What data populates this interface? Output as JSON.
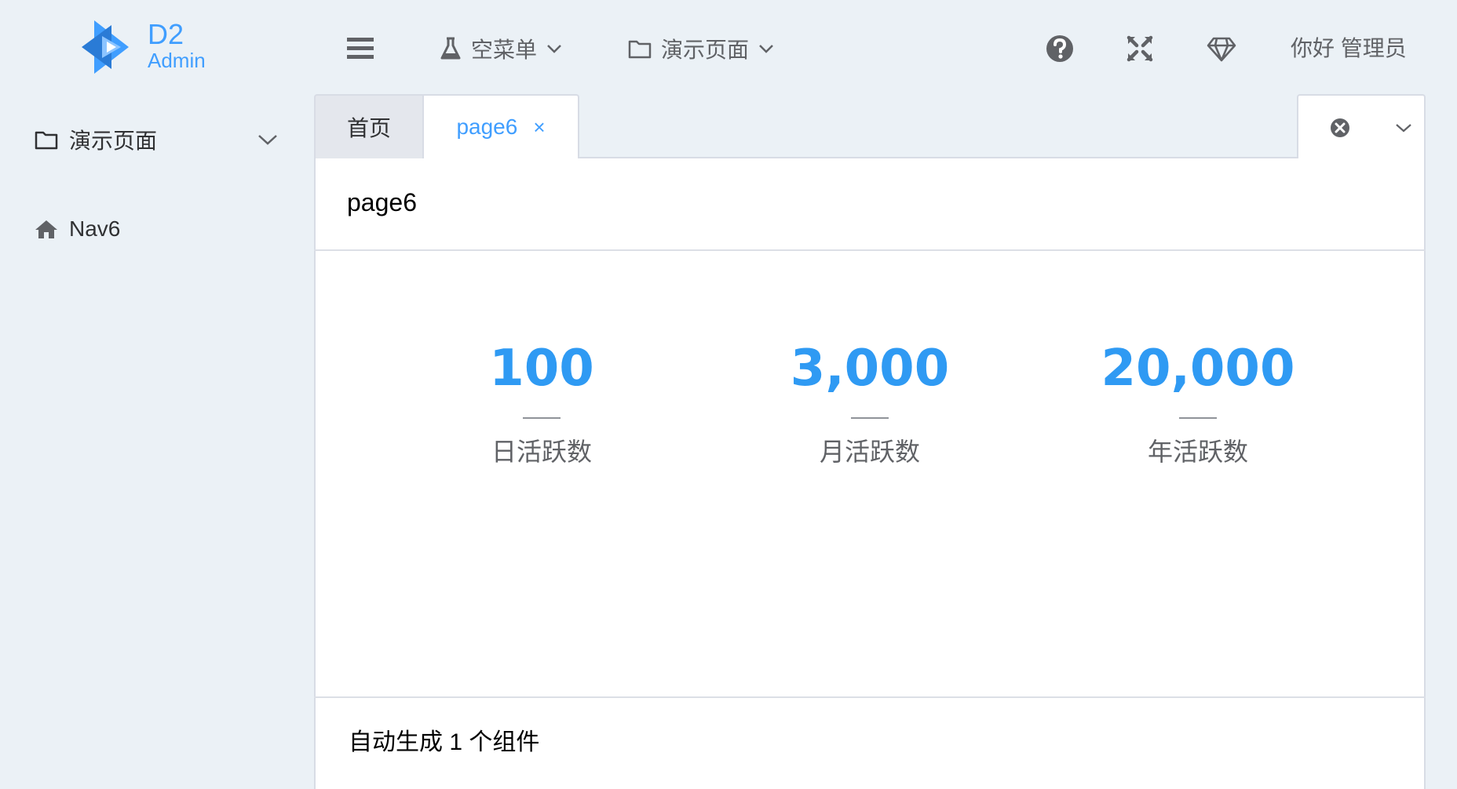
{
  "logo": {
    "line1": "D2",
    "line2": "Admin"
  },
  "header": {
    "menus": [
      {
        "label": "空菜单",
        "icon": "flask-icon"
      },
      {
        "label": "演示页面",
        "icon": "folder-icon"
      }
    ],
    "greeting": "你好 管理员",
    "icons": [
      "help-circle-icon",
      "fullscreen-icon",
      "diamond-icon"
    ]
  },
  "sidebar": {
    "submenu": {
      "label": "演示页面",
      "icon": "folder-icon"
    },
    "items": [
      {
        "label": "Nav6",
        "icon": "home-icon"
      }
    ]
  },
  "tabs": [
    {
      "label": "首页"
    },
    {
      "label": "page6",
      "active": true
    }
  ],
  "page": {
    "title": "page6",
    "stats": [
      {
        "value": "100",
        "label": "日活跃数"
      },
      {
        "value": "3,000",
        "label": "月活跃数"
      },
      {
        "value": "20,000",
        "label": "年活跃数"
      }
    ],
    "footer": "自动生成 1 个组件"
  },
  "colors": {
    "accent": "#409eff",
    "stat": "#2f9af3",
    "background": "#ebf1f6"
  }
}
